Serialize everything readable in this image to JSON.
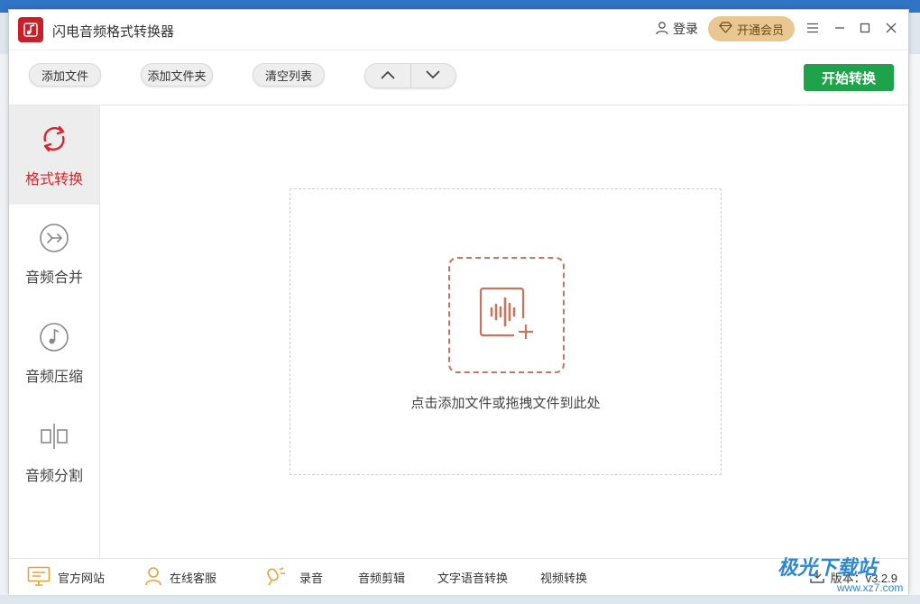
{
  "app": {
    "title": "闪电音频格式转换器",
    "login_label": "登录",
    "vip_label": "开通会员"
  },
  "toolbar": {
    "add_file": "添加文件",
    "add_folder": "添加文件夹",
    "clear_list": "清空列表",
    "start": "开始转换"
  },
  "sidebar": {
    "items": [
      {
        "label": "格式转换",
        "icon": "refresh-icon",
        "active": true
      },
      {
        "label": "音频合并",
        "icon": "merge-icon",
        "active": false
      },
      {
        "label": "音频压缩",
        "icon": "music-note-icon",
        "active": false
      },
      {
        "label": "音频分割",
        "icon": "split-icon",
        "active": false
      }
    ]
  },
  "dropzone": {
    "text": "点击添加文件或拖拽文件到此处"
  },
  "footer": {
    "official_site": "官方网站",
    "online_service": "在线客服",
    "record": "录音",
    "audio_edit": "音频剪辑",
    "tts": "文字语音转换",
    "video_convert": "视频转换",
    "version": "版本：v3.2.9"
  },
  "watermark": {
    "text": "极光下载站",
    "url": "www.xz7.com"
  },
  "colors": {
    "accent_red": "#d8262c",
    "start_green": "#1fa34a",
    "vip_gold": "#e8c792",
    "drop_orange": "#c9745b"
  }
}
